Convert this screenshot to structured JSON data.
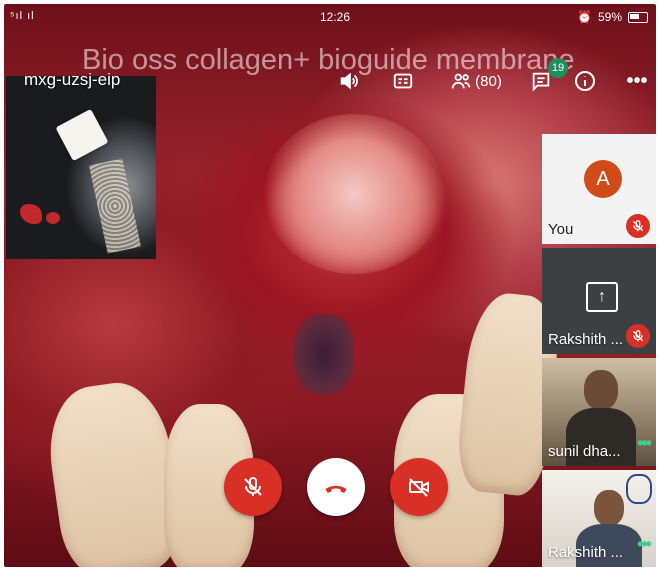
{
  "status_bar": {
    "signal": "⁵ıl ıl",
    "time": "12:26",
    "alarm": "⏰",
    "battery": "59%"
  },
  "overlay_title": "Bio oss collagen+ bioguide membrane",
  "meeting_code": "mxg-uzsj-eip",
  "toolbar": {
    "participants_count": "(80)",
    "chat_badge": "19"
  },
  "participants": [
    {
      "name": "You",
      "avatar_letter": "A",
      "state": "muted"
    },
    {
      "name": "Rakshith ...",
      "state": "presenting-muted"
    },
    {
      "name": "sunil dha...",
      "state": "talking"
    },
    {
      "name": "Rakshith ...",
      "state": "talking"
    }
  ],
  "colors": {
    "mute_red": "#d93025",
    "avatar_orange": "#d04a1a",
    "talking_green": "#3ecf8e",
    "chat_badge_green": "#1e8e5a"
  }
}
